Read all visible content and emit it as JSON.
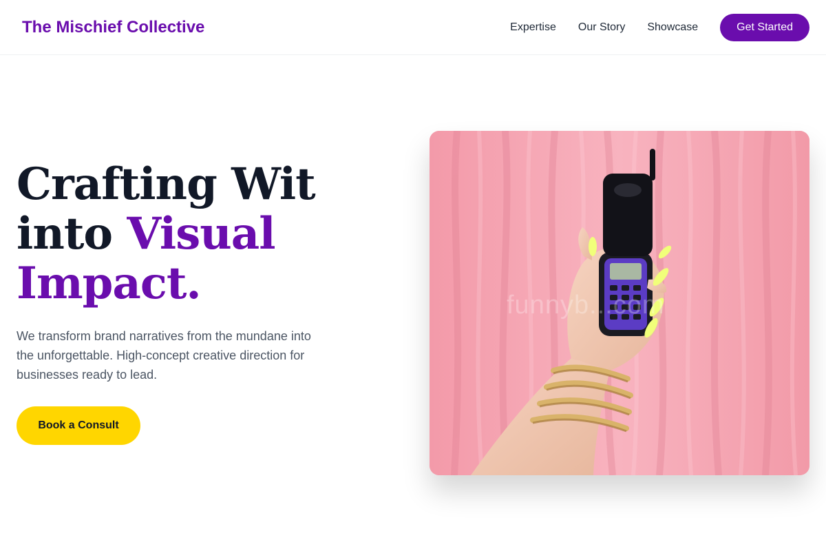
{
  "header": {
    "brand": "The Mischief Collective",
    "nav": [
      "Expertise",
      "Our Story",
      "Showcase"
    ],
    "cta_label": "Get Started"
  },
  "hero": {
    "title_line1": "Crafting Wit",
    "title_line2_plain": "into ",
    "title_line2_accent": "Visual",
    "title_line3_accent": "Impact.",
    "subtitle": "We transform brand narratives from the mundane into the unforgettable. High-concept creative direction for businesses ready to lead.",
    "cta_label": "Book a Consult",
    "image": {
      "watermark": "funnyb...com"
    }
  },
  "colors": {
    "brand_purple": "#6a0dad",
    "cta_yellow": "#ffd600",
    "curtain_pink": "#f6aab7",
    "text_dark": "#111827",
    "text_muted": "#4b5563"
  }
}
